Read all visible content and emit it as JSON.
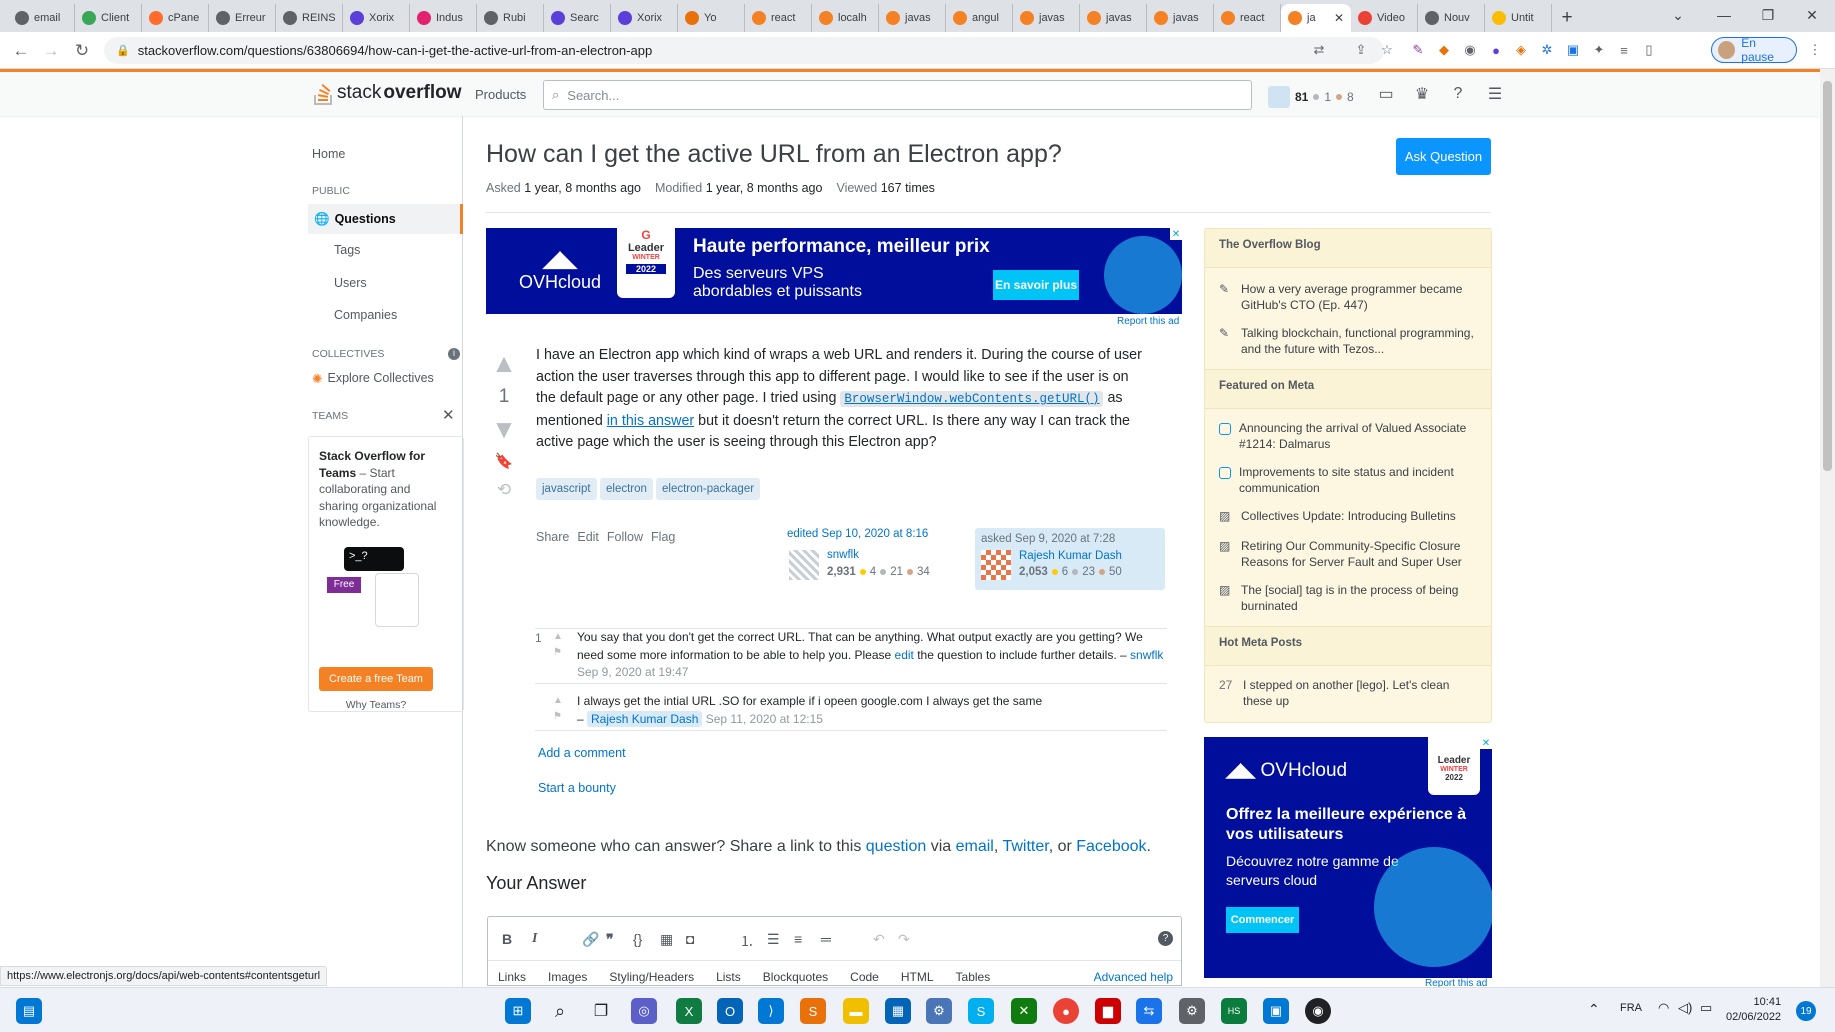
{
  "browser": {
    "tabs": [
      {
        "label": "email",
        "color": "#5f6368"
      },
      {
        "label": "Client",
        "color": "#3aa757"
      },
      {
        "label": "cPane",
        "color": "#ff6c2c"
      },
      {
        "label": "Erreur",
        "color": "#5f6368"
      },
      {
        "label": "REINS",
        "color": "#5f6368"
      },
      {
        "label": "Xorix",
        "color": "#5b3fd8"
      },
      {
        "label": "Indus",
        "color": "#e2226f"
      },
      {
        "label": "Rubi",
        "color": "#5f6368"
      },
      {
        "label": "Searc",
        "color": "#5b3fd8"
      },
      {
        "label": "Xorix",
        "color": "#5b3fd8"
      },
      {
        "label": "Yo",
        "color": "#e8710a"
      },
      {
        "label": "react",
        "color": "#f48225"
      },
      {
        "label": "localh",
        "color": "#f48225"
      },
      {
        "label": "javas",
        "color": "#f48225"
      },
      {
        "label": "angul",
        "color": "#f48225"
      },
      {
        "label": "javas",
        "color": "#f48225"
      },
      {
        "label": "javas",
        "color": "#f48225"
      },
      {
        "label": "javas",
        "color": "#f48225"
      },
      {
        "label": "react",
        "color": "#f48225"
      },
      {
        "label": "ja",
        "color": "#f48225",
        "active": true
      },
      {
        "label": "Video",
        "color": "#ea4335"
      },
      {
        "label": "Nouv",
        "color": "#5f6368"
      },
      {
        "label": "Untit",
        "color": "#fbbc04"
      }
    ],
    "url": "stackoverflow.com/questions/63806694/how-can-i-get-the-active-url-from-an-electron-app",
    "profile_label": "En pause",
    "status_link": "https://www.electronjs.org/docs/api/web-contents#contentsgeturl"
  },
  "topbar": {
    "logo_light": "stack",
    "logo_bold": "overflow",
    "products": "Products",
    "search_placeholder": "Search...",
    "rep": "81",
    "silver": "1",
    "bronze": "8"
  },
  "leftnav": {
    "home": "Home",
    "public": "PUBLIC",
    "questions": "Questions",
    "tags": "Tags",
    "users": "Users",
    "companies": "Companies",
    "collectives": "COLLECTIVES",
    "explore": "Explore Collectives",
    "teams": "TEAMS",
    "teams_title": "Stack Overflow for Teams",
    "teams_desc": " – Start collaborating and sharing organizational knowledge.",
    "free_badge": "Free",
    "cta": "Create a free Team",
    "why": "Why Teams?"
  },
  "question": {
    "title": "How can I get the active URL from an Electron app?",
    "ask_button": "Ask Question",
    "asked_label": "Asked",
    "asked_value": "1 year, 8 months ago",
    "modified_label": "Modified",
    "modified_value": "1 year, 8 months ago",
    "viewed_label": "Viewed",
    "viewed_value": "167 times",
    "score": "1",
    "body_1": "I have an Electron app which kind of wraps a web URL and renders it. During the course of user action the user traverses through this app to different page. I would like to see if the user is on the default page or any other page. I tried using ",
    "code": "BrowserWindow.webContents.getURL()",
    "body_2": " as mentioned ",
    "link": "in this answer",
    "body_3": " but it doesn't return the correct URL. Is there any way I can track the active page which the user is seeing through this Electron app?",
    "tags": [
      "javascript",
      "electron",
      "electron-packager"
    ],
    "menu": [
      "Share",
      "Edit",
      "Follow",
      "Flag"
    ],
    "edited": {
      "label": "edited Sep 10, 2020 at 8:16",
      "user": "snwflk",
      "rep": "2,931",
      "silver": "4",
      "bronze_a": "21",
      "bronze_b": "34"
    },
    "asked": {
      "label": "asked Sep 9, 2020 at 7:28",
      "user": "Rajesh Kumar Dash",
      "rep": "2,053",
      "gold": "6",
      "silver": "23",
      "bronze": "50"
    }
  },
  "ad_top": {
    "brand": "OVHcloud",
    "badge": "Leader",
    "badge_sub": "WINTER",
    "badge_year": "2022",
    "headline": "Haute performance, meilleur prix",
    "subline": "Des serveurs VPS abordables et puissants",
    "cta": "En savoir plus",
    "report": "Report this ad"
  },
  "comments": [
    {
      "score": "1",
      "text": "You say that you don't get the correct URL. That can be anything. What output exactly are you getting? We need some more information to be able to help you. Please ",
      "link": "edit",
      "text2": " the question to include further details. – ",
      "user": "snwflk",
      "date": "Sep 9, 2020 at 19:47"
    },
    {
      "score": "",
      "text": "I always get the intial URL .SO for example if i opeen google.com I always get the same",
      "dash": "– ",
      "user": "Rajesh Kumar Dash",
      "date": "Sep 11, 2020 at 12:15"
    }
  ],
  "actions": {
    "add_comment": "Add a comment",
    "bounty": "Start a bounty"
  },
  "share": {
    "prefix": "Know someone who can answer? Share a link to this ",
    "question": "question",
    "via": " via ",
    "email": "email",
    "c1": ", ",
    "twitter": "Twitter",
    "or": ", or ",
    "facebook": "Facebook",
    "end": "."
  },
  "your_answer": "Your Answer",
  "editor_tabs": [
    "Links",
    "Images",
    "Styling/Headers",
    "Lists",
    "Blockquotes",
    "Code",
    "HTML",
    "Tables"
  ],
  "advanced_help": "Advanced help",
  "sidebar": {
    "blog_title": "The Overflow Blog",
    "blog_items": [
      "How a very average programmer became GitHub's CTO (Ep. 447)",
      "Talking blockchain, functional programming, and the future with Tezos..."
    ],
    "meta_title": "Featured on Meta",
    "meta_items": [
      "Announcing the arrival of Valued Associate #1214: Dalmarus",
      "Improvements to site status and incident communication",
      "Collectives Update: Introducing Bulletins",
      "Retiring Our Community-Specific Closure Reasons for Server Fault and Super User",
      "The [social] tag is in the process of being burninated"
    ],
    "hot_title": "Hot Meta Posts",
    "hot_score": "27",
    "hot_item": "I stepped on another [lego]. Let's clean these up"
  },
  "ad_side": {
    "brand": "OVHcloud",
    "badge": "Leader",
    "badge_sub": "WINTER",
    "badge_year": "2022",
    "headline": "Offrez la meilleure expérience à vos utilisateurs",
    "subline": "Découvrez notre gamme de serveurs cloud",
    "cta": "Commencer",
    "report": "Report this ad"
  },
  "taskbar": {
    "lang": "FRA",
    "time": "10:41",
    "date": "02/06/2022",
    "notif": "19"
  }
}
